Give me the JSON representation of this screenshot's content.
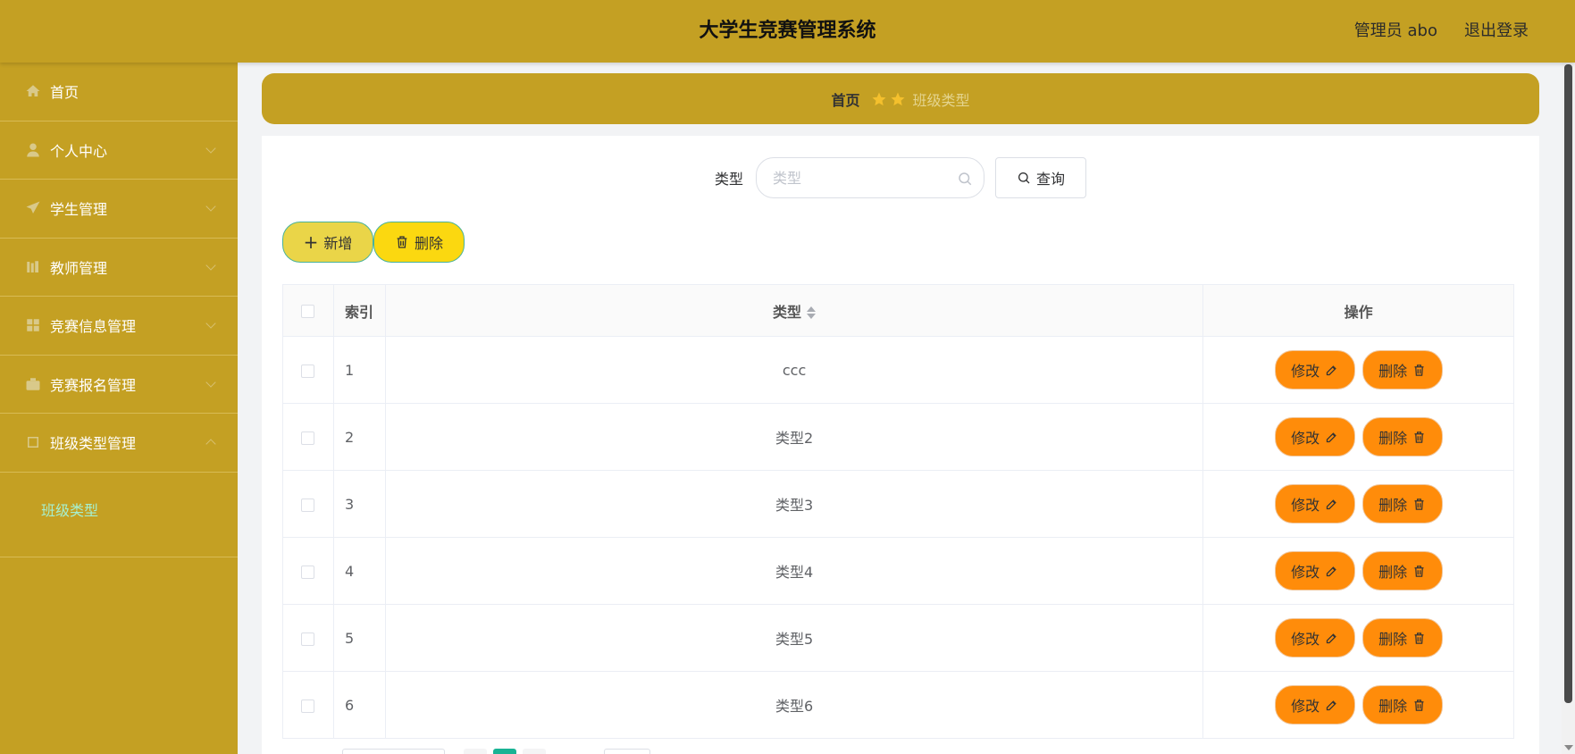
{
  "header": {
    "title": "大学生竞赛管理系统",
    "user": "管理员 abo",
    "logout": "退出登录"
  },
  "sidebar": {
    "items": [
      {
        "label": "首页",
        "icon": "home-icon"
      },
      {
        "label": "个人中心",
        "icon": "user-icon"
      },
      {
        "label": "学生管理",
        "icon": "send-icon"
      },
      {
        "label": "教师管理",
        "icon": "books-icon"
      },
      {
        "label": "竞赛信息管理",
        "icon": "grid-icon"
      },
      {
        "label": "竞赛报名管理",
        "icon": "briefcase-icon"
      },
      {
        "label": "班级类型管理",
        "icon": "frame-icon"
      }
    ],
    "sub_item": "班级类型"
  },
  "breadcrumb": {
    "home": "首页",
    "current": "班级类型"
  },
  "search": {
    "label": "类型",
    "placeholder": "类型",
    "value": "",
    "query_button": "查询"
  },
  "actions": {
    "add": "新增",
    "delete": "删除"
  },
  "table": {
    "headers": {
      "index": "索引",
      "type": "类型",
      "operation": "操作"
    },
    "edit_label": "修改",
    "delete_label": "删除",
    "rows": [
      {
        "index": "1",
        "type": "ccc"
      },
      {
        "index": "2",
        "type": "类型2"
      },
      {
        "index": "3",
        "type": "类型3"
      },
      {
        "index": "4",
        "type": "类型4"
      },
      {
        "index": "5",
        "type": "类型5"
      },
      {
        "index": "6",
        "type": "类型6"
      }
    ]
  },
  "colors": {
    "theme": "#c4a023",
    "edit_button": "#ff8c0a",
    "add_button": "#ead548",
    "delete_button": "#fbd810",
    "submenu_text": "#a6f0cf"
  }
}
